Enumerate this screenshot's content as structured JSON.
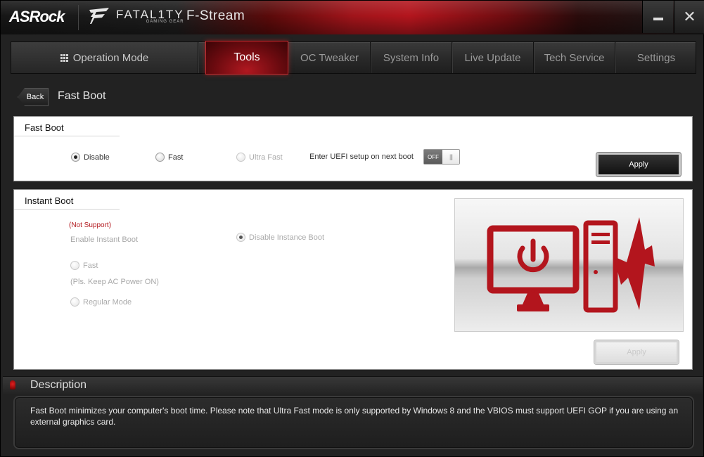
{
  "titlebar": {
    "brand": "ASRock",
    "logo_text": "FATAL1TY",
    "logo_sub": "GAMING GEAR",
    "app_title": "F-Stream"
  },
  "nav": {
    "tabs": [
      {
        "label": "Operation Mode"
      },
      {
        "label": "Tools",
        "active": true
      },
      {
        "label": "OC Tweaker"
      },
      {
        "label": "System Info"
      },
      {
        "label": "Live Update"
      },
      {
        "label": "Tech Service"
      },
      {
        "label": "Settings"
      }
    ]
  },
  "breadcrumb": {
    "back_label": "Back",
    "page_title": "Fast Boot"
  },
  "fast_boot": {
    "heading": "Fast Boot",
    "options": [
      {
        "label": "Disable",
        "checked": true,
        "disabled": false
      },
      {
        "label": "Fast",
        "checked": false,
        "disabled": false
      },
      {
        "label": "Ultra Fast",
        "checked": false,
        "disabled": true
      }
    ],
    "uefi_label": "Enter UEFI setup on next boot",
    "uefi_toggle": "OFF",
    "apply_label": "Apply"
  },
  "instant_boot": {
    "heading": "Instant Boot",
    "not_support": "(Not Support)",
    "enable_label": "Enable Instant Boot",
    "disable_option": "Disable Instance Boot",
    "fast_option": "Fast",
    "fast_note": "(Pls. Keep AC Power ON)",
    "regular_option": "Regular Mode",
    "apply_label": "Apply"
  },
  "description": {
    "title": "Description",
    "text": "Fast Boot minimizes your computer's boot time. Please note that Ultra Fast mode is only supported by Windows 8 and the VBIOS must support UEFI GOP if you are using an external graphics card."
  },
  "colors": {
    "accent_red": "#b2161c",
    "panel_bg": "#ffffff",
    "chrome_bg": "#222222"
  }
}
